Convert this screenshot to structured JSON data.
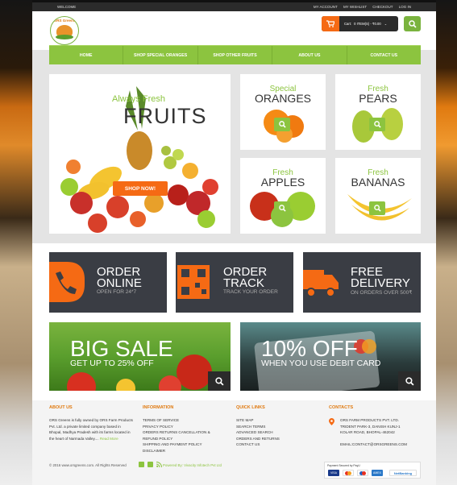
{
  "topbar": {
    "welcome": "WELCOME",
    "links": [
      "MY ACCOUNT",
      "MY WISHLIST",
      "CHECKOUT",
      "LOG IN"
    ]
  },
  "logo": {
    "text": "ORS Greens"
  },
  "cart": {
    "label": "Cart:",
    "summary": "0 ITEM(S) - ₹0.00"
  },
  "nav": [
    "HOME",
    "SHOP SPECIAL ORANGES",
    "SHOP OTHER FRUITS",
    "ABOUT US",
    "CONTACT US"
  ],
  "hero": {
    "line1": "Always Fresh",
    "line2": "FRUITS",
    "cta": "SHOP NOW!"
  },
  "tiles": [
    {
      "small": "Special",
      "big": "ORANGES"
    },
    {
      "small": "Fresh",
      "big": "PEARS"
    },
    {
      "small": "Fresh",
      "big": "APPLES"
    },
    {
      "small": "Fresh",
      "big": "BANANAS"
    }
  ],
  "features": [
    {
      "title1": "ORDER",
      "title2": "ONLINE",
      "sub": "OPEN FOR 24*7"
    },
    {
      "title1": "ORDER",
      "title2": "TRACK",
      "sub": "TRACK YOUR ORDER"
    },
    {
      "title1": "FREE",
      "title2": "DELIVERY",
      "sub": "ON ORDERS OVER 500₹"
    }
  ],
  "promos": [
    {
      "title": "BIG SALE",
      "sub": "GET UP TO 25% OFF"
    },
    {
      "title": "10% OFF",
      "sub": "WHEN YOU USE DEBIT CARD"
    }
  ],
  "footer": {
    "about": {
      "heading": "ABOUT US",
      "text": "ORS Greens is fully owned by ORS Farm Products Pvt. Ltd. a private limited company based in Bhopal, Madhya Pradesh with its farms located in the heart of Narmada Valley....",
      "more": "Read More"
    },
    "info": {
      "heading": "INFORMATION",
      "items": [
        "TERMS OF SERVICE",
        "PRIVACY POLICY",
        "ORDERS RETURNS CANCELLATION & REFUND POLICY",
        "SHIPPING AND PAYMENT POLICY",
        "DISCLAIMER"
      ]
    },
    "quick": {
      "heading": "QUICK LINKS",
      "items": [
        "SITE MAP",
        "SEARCH TERMS",
        "ADVANCED SEARCH",
        "ORDERS AND RETURNS",
        "CONTACT US"
      ]
    },
    "contact": {
      "heading": "CONTACTS",
      "address": [
        "ORS FARM PRODUCTS PVT. LTD.",
        "TRIDENT PARK-3, DANISH KUNJ-1",
        "KOLAR ROAD, BHOPAL-462042"
      ],
      "email": "EMAIL:CONTACT@ORSGREENS.COM"
    },
    "copyright": "© 2016 www.orsgreens.com. All Rights Reserved",
    "powered": "Powered By: Vivacity Infotech Pvt Ltd",
    "payment": {
      "title": "Payment Secured by PayU",
      "cards": [
        "VISA",
        "MC",
        "MC",
        "AMEX",
        "NetBanking"
      ]
    }
  },
  "colors": {
    "green": "#8cc43f",
    "orange": "#f56a14",
    "dark": "#3a3d44"
  }
}
